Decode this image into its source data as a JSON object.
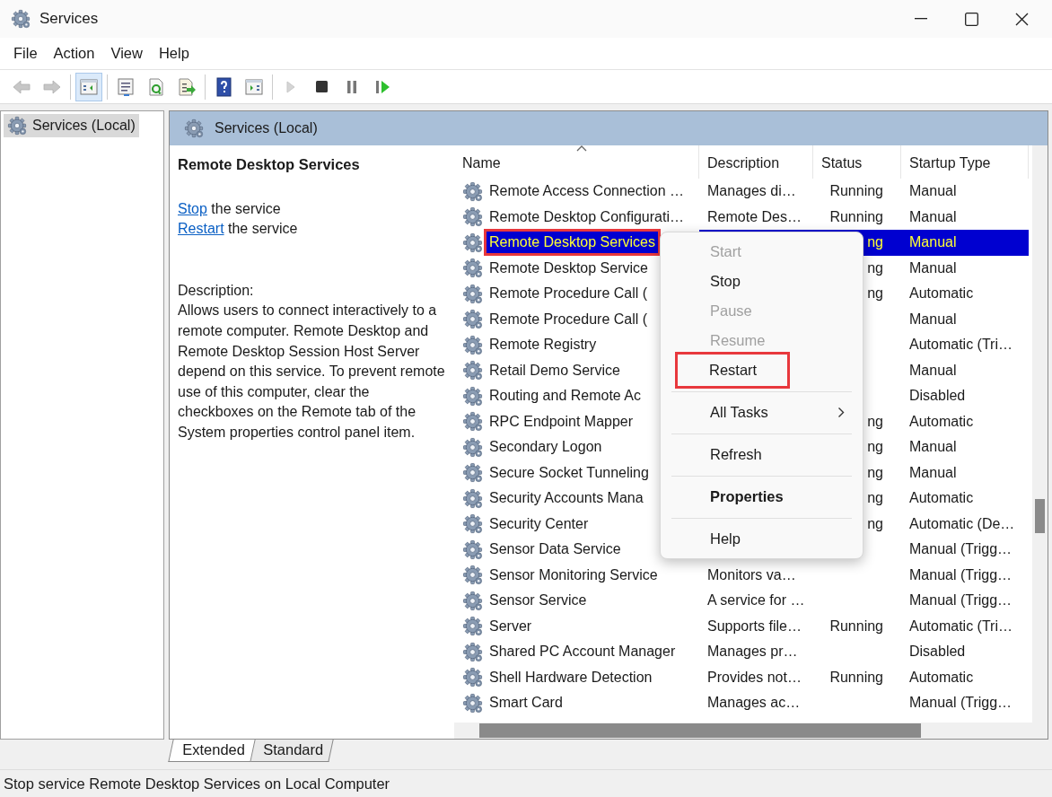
{
  "window": {
    "title": "Services"
  },
  "menu_bar": [
    "File",
    "Action",
    "View",
    "Help"
  ],
  "toolbar": {
    "groups": [
      {
        "buttons": [
          {
            "kind": "back",
            "disabled": true,
            "pressed": false
          },
          {
            "kind": "forward",
            "disabled": true,
            "pressed": false
          }
        ]
      },
      {
        "buttons": [
          {
            "kind": "console-tree",
            "disabled": false,
            "pressed": true
          }
        ]
      },
      {
        "buttons": [
          {
            "kind": "properties",
            "disabled": false,
            "pressed": false
          },
          {
            "kind": "refresh",
            "disabled": false,
            "pressed": false
          },
          {
            "kind": "export",
            "disabled": false,
            "pressed": false
          }
        ]
      },
      {
        "buttons": [
          {
            "kind": "help",
            "disabled": false,
            "pressed": false
          },
          {
            "kind": "action-pane",
            "disabled": false,
            "pressed": false
          }
        ]
      },
      {
        "buttons": [
          {
            "kind": "start",
            "disabled": true,
            "pressed": false
          },
          {
            "kind": "stop",
            "disabled": false,
            "pressed": false
          },
          {
            "kind": "pause",
            "disabled": false,
            "pressed": false
          },
          {
            "kind": "resume",
            "disabled": false,
            "pressed": false
          }
        ]
      }
    ]
  },
  "tree": [
    {
      "label": "Services (Local)",
      "selected": true
    }
  ],
  "pane_header": {
    "title": "Services (Local)"
  },
  "details": {
    "title": "Remote Desktop Services",
    "actions": [
      {
        "link": "Stop",
        "text": " the service"
      },
      {
        "link": "Restart",
        "text": " the service"
      }
    ],
    "description_label": "Description:",
    "description": "Allows users to connect interactively to a remote computer. Remote Desktop and Remote Desktop Session Host Server depend on this service. To prevent remote use of this computer, clear the checkboxes on the Remote tab of the System properties control panel item."
  },
  "table": {
    "columns": [
      {
        "label": "Name",
        "sorted": true
      },
      {
        "label": "Description",
        "sorted": false
      },
      {
        "label": "Status",
        "sorted": false
      },
      {
        "label": "Startup Type",
        "sorted": false
      }
    ],
    "rows": [
      {
        "name": "Remote Access Connection …",
        "description": "Manages di…",
        "status": "Running",
        "startup_type": "Manual",
        "selected": false,
        "marked": false
      },
      {
        "name": "Remote Desktop Configurati…",
        "description": "Remote Des…",
        "status": "Running",
        "startup_type": "Manual",
        "selected": false,
        "marked": false
      },
      {
        "name": "Remote Desktop Services",
        "status": "ng",
        "startup_type": "Manual",
        "selected": true,
        "marked": true
      },
      {
        "name": "Remote Desktop Service",
        "status": "ng",
        "startup_type": "Manual",
        "selected": false,
        "marked": false
      },
      {
        "name": "Remote Procedure Call (",
        "status": "ng",
        "startup_type": "Automatic",
        "selected": false,
        "marked": false
      },
      {
        "name": "Remote Procedure Call (",
        "startup_type": "Manual",
        "selected": false,
        "marked": false
      },
      {
        "name": "Remote Registry",
        "startup_type": "Automatic (Tri…",
        "selected": false,
        "marked": false
      },
      {
        "name": "Retail Demo Service",
        "startup_type": "Manual",
        "selected": false,
        "marked": false
      },
      {
        "name": "Routing and Remote Ac",
        "startup_type": "Disabled",
        "selected": false,
        "marked": false
      },
      {
        "name": "RPC Endpoint Mapper",
        "status": "ng",
        "startup_type": "Automatic",
        "selected": false,
        "marked": false
      },
      {
        "name": "Secondary Logon",
        "status": "ng",
        "startup_type": "Manual",
        "selected": false,
        "marked": false
      },
      {
        "name": "Secure Socket Tunneling",
        "status": "ng",
        "startup_type": "Manual",
        "selected": false,
        "marked": false
      },
      {
        "name": "Security Accounts Mana",
        "status": "ng",
        "startup_type": "Automatic",
        "selected": false,
        "marked": false
      },
      {
        "name": "Security Center",
        "status": "ng",
        "startup_type": "Automatic (De…",
        "selected": false,
        "marked": false
      },
      {
        "name": "Sensor Data Service",
        "startup_type": "Manual (Trigg…",
        "selected": false,
        "marked": false
      },
      {
        "name": "Sensor Monitoring Service",
        "description": "Monitors va…",
        "startup_type": "Manual (Trigg…",
        "selected": false,
        "marked": false
      },
      {
        "name": "Sensor Service",
        "description": "A service for …",
        "startup_type": "Manual (Trigg…",
        "selected": false,
        "marked": false
      },
      {
        "name": "Server",
        "description": "Supports file…",
        "status": "Running",
        "startup_type": "Automatic (Tri…",
        "selected": false,
        "marked": false
      },
      {
        "name": "Shared PC Account Manager",
        "description": "Manages pr…",
        "startup_type": "Disabled",
        "selected": false,
        "marked": false
      },
      {
        "name": "Shell Hardware Detection",
        "description": "Provides not…",
        "status": "Running",
        "startup_type": "Automatic",
        "selected": false,
        "marked": false
      },
      {
        "name": "Smart Card",
        "description": "Manages ac…",
        "startup_type": "Manual (Trigg…",
        "selected": false,
        "marked": false
      }
    ]
  },
  "context_menu": {
    "items": [
      {
        "kind": "item",
        "label": "Start",
        "disabled": true,
        "marked": false,
        "default": false,
        "submenu": false
      },
      {
        "kind": "item",
        "label": "Stop",
        "disabled": false,
        "marked": false,
        "default": false,
        "submenu": false
      },
      {
        "kind": "item",
        "label": "Pause",
        "disabled": true,
        "marked": false,
        "default": false,
        "submenu": false
      },
      {
        "kind": "item",
        "label": "Resume",
        "disabled": true,
        "marked": false,
        "default": false,
        "submenu": false
      },
      {
        "kind": "item",
        "label": "Restart",
        "disabled": false,
        "marked": true,
        "default": false,
        "submenu": false
      },
      {
        "kind": "separator"
      },
      {
        "kind": "item",
        "label": "All Tasks",
        "disabled": false,
        "marked": false,
        "default": false,
        "submenu": true
      },
      {
        "kind": "separator"
      },
      {
        "kind": "item",
        "label": "Refresh",
        "disabled": false,
        "marked": false,
        "default": false,
        "submenu": false
      },
      {
        "kind": "separator"
      },
      {
        "kind": "item",
        "label": "Properties",
        "disabled": false,
        "marked": false,
        "default": true,
        "submenu": false
      },
      {
        "kind": "separator"
      },
      {
        "kind": "item",
        "label": "Help",
        "disabled": false,
        "marked": false,
        "default": false,
        "submenu": false
      }
    ]
  },
  "view_tabs": [
    {
      "label": "Extended",
      "selected": true
    },
    {
      "label": "Standard",
      "selected": false
    }
  ],
  "status_bar": {
    "text": "Stop service Remote Desktop Services on Local Computer"
  }
}
